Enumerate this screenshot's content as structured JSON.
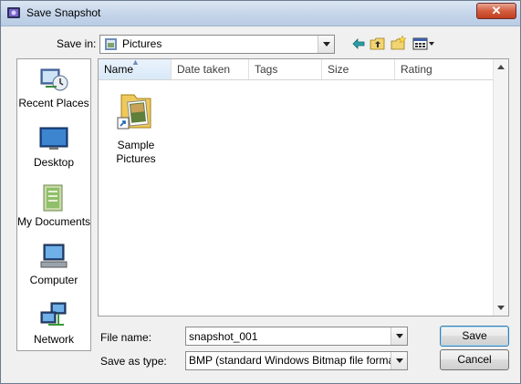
{
  "window": {
    "title": "Save Snapshot",
    "close_symbol": "✕"
  },
  "toolbar": {
    "save_in_label": "Save in:",
    "location": "Pictures",
    "icons": [
      "back-arrow-icon",
      "up-folder-icon",
      "new-folder-icon",
      "views-menu-icon"
    ]
  },
  "places": [
    {
      "label": "Recent Places",
      "icon": "recent-places-icon"
    },
    {
      "label": "Desktop",
      "icon": "desktop-icon"
    },
    {
      "label": "My Documents",
      "icon": "my-documents-icon"
    },
    {
      "label": "Computer",
      "icon": "computer-icon"
    },
    {
      "label": "Network",
      "icon": "network-icon"
    }
  ],
  "columns": [
    "Name",
    "Date taken",
    "Tags",
    "Size",
    "Rating"
  ],
  "files": [
    {
      "name_line1": "Sample",
      "name_line2": "Pictures",
      "icon": "shortcut-folder-icon"
    }
  ],
  "form": {
    "file_name_label": "File name:",
    "file_name_value": "snapshot_001",
    "save_type_label": "Save as type:",
    "save_type_value": "BMP (standard Windows Bitmap file format)"
  },
  "buttons": {
    "save": "Save",
    "cancel": "Cancel"
  },
  "colors": {
    "titlebar": "#c6d6ea",
    "close": "#c0401f",
    "selected_header": "#d9e9f8",
    "default_button_border": "#3c7fb1"
  }
}
